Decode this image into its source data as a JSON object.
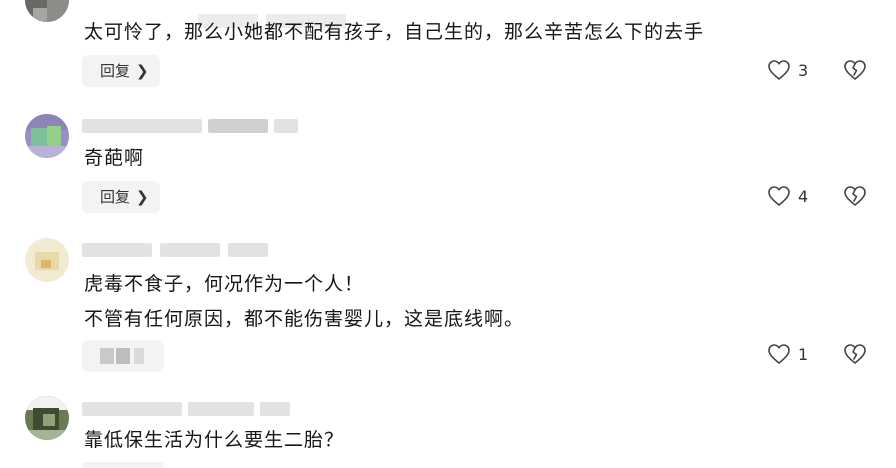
{
  "comments": [
    {
      "text_lines": [
        "太可怜了，那么小她都不配有孩子，自己生的，那么辛苦怎么下的去手"
      ],
      "reply_label": "回复",
      "likes": "3"
    },
    {
      "text_lines": [
        "奇葩啊"
      ],
      "reply_label": "回复",
      "likes": "4"
    },
    {
      "text_lines": [
        "虎毒不食子，何况作为一个人！",
        "不管有任何原因，都不能伤害婴儿，这是底线啊。"
      ],
      "likes": "1"
    },
    {
      "text_lines": [
        "靠低保生活为什么要生二胎？"
      ]
    }
  ],
  "icons": {
    "like": "heart-outline-icon",
    "dislike": "broken-heart-icon",
    "reply_chevron": "chevron-right-icon"
  },
  "colors": {
    "text": "#161616",
    "meta_blur": "#e2e2e2",
    "button_bg": "#f3f3f3"
  }
}
